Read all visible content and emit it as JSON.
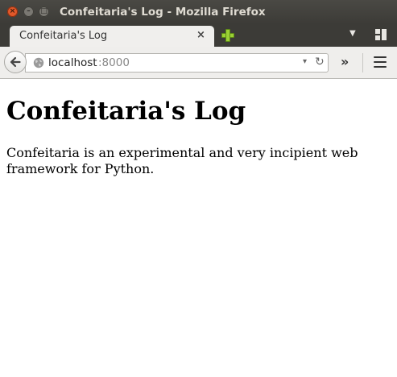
{
  "window": {
    "title": "Confeitaria's Log - Mozilla Firefox",
    "controls": {
      "close": "×",
      "minimize": "–",
      "maximize": "□"
    }
  },
  "tabs": [
    {
      "title": "Confeitaria's Log",
      "close_label": "×"
    }
  ],
  "toolbar": {
    "url_host": "localhost",
    "url_port": ":8000",
    "dropmarker": "▾",
    "reload": "↻",
    "overflow": "»",
    "icons": [
      "back-icon",
      "globe-icon",
      "dropdown-icon",
      "reload-icon",
      "overflow-icon",
      "menu-icon",
      "new-tab-icon",
      "tab-list-icon",
      "tab-groups-icon"
    ]
  },
  "page": {
    "heading": "Confeitaria's Log",
    "paragraph": "Confeitaria is an experimental and very incipient web framework for Python."
  },
  "colors": {
    "titlebar": "#3c3b37",
    "close_button": "#e0582a",
    "new_tab_green": "#9bd035"
  }
}
